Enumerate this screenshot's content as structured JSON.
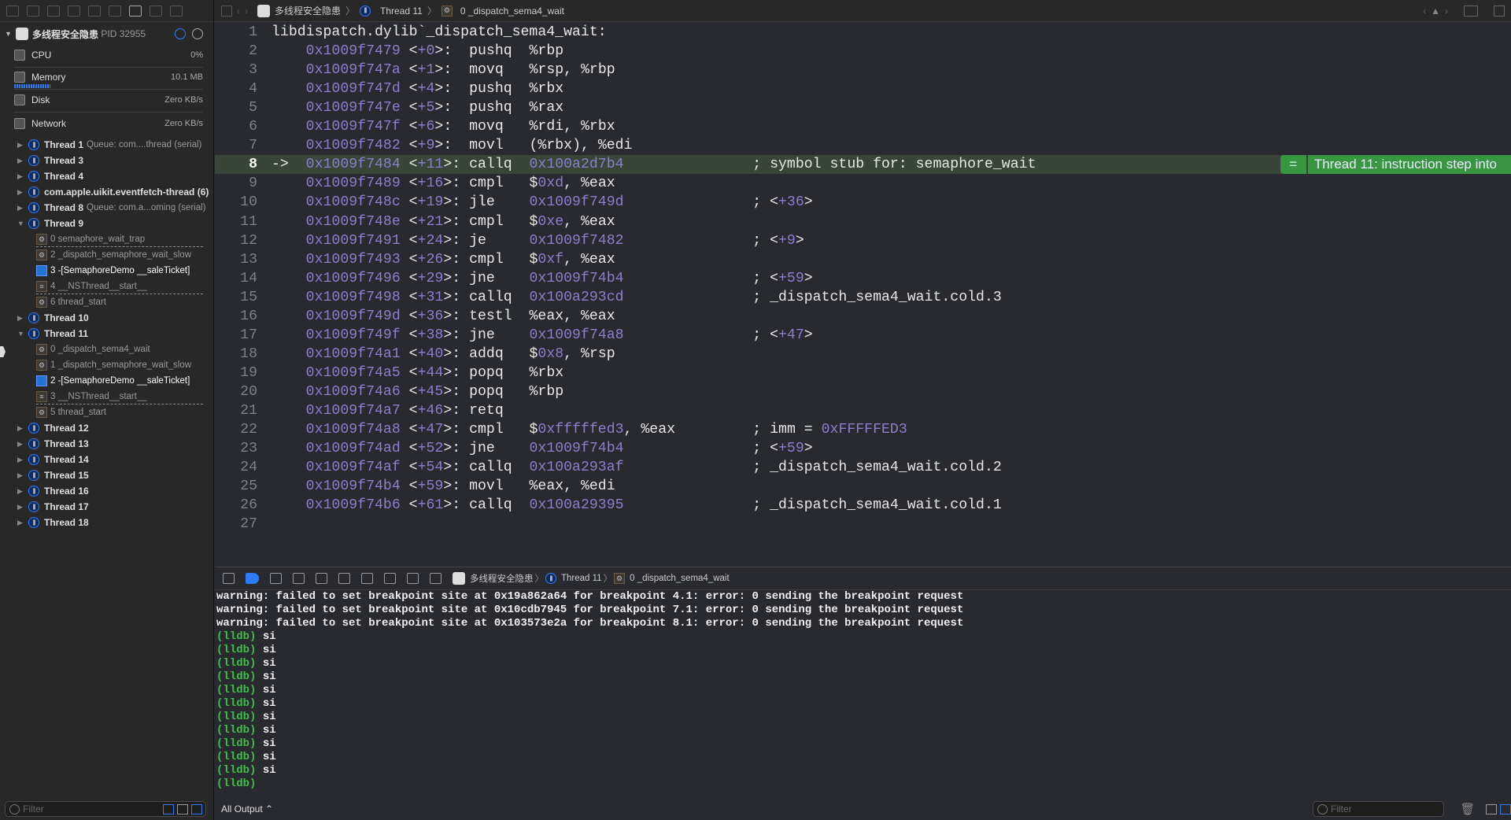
{
  "process": {
    "name": "多线程安全隐患",
    "pid": "PID 32955"
  },
  "metrics": [
    {
      "label": "CPU",
      "value": "0%"
    },
    {
      "label": "Memory",
      "value": "10.1 MB"
    },
    {
      "label": "Disk",
      "value": "Zero KB/s"
    },
    {
      "label": "Network",
      "value": "Zero KB/s"
    }
  ],
  "threads": [
    {
      "label": "Thread 1",
      "queue": "Queue: com....thread (serial)",
      "expanded": false
    },
    {
      "label": "Thread 3",
      "queue": "",
      "expanded": false
    },
    {
      "label": "Thread 4",
      "queue": "",
      "expanded": false
    },
    {
      "label": "com.apple.uikit.eventfetch-thread (6)",
      "queue": "",
      "expanded": false
    },
    {
      "label": "Thread 8",
      "queue": "Queue: com.a...oming (serial)",
      "expanded": false
    },
    {
      "label": "Thread 9",
      "queue": "",
      "expanded": true,
      "frames": [
        {
          "label": "0 semaphore_wait_trap",
          "kind": "sys",
          "sepAfter": true
        },
        {
          "label": "2 _dispatch_semaphore_wait_slow",
          "kind": "sys"
        },
        {
          "label": "3 -[SemaphoreDemo __saleTicket]",
          "kind": "user"
        },
        {
          "label": "4 __NSThread__start__",
          "kind": "fw",
          "sepAfter": true
        },
        {
          "label": "6 thread_start",
          "kind": "sys"
        }
      ]
    },
    {
      "label": "Thread 10",
      "queue": "",
      "expanded": false
    },
    {
      "label": "Thread 11",
      "queue": "",
      "expanded": true,
      "frames": [
        {
          "label": "0 _dispatch_sema4_wait",
          "kind": "sys"
        },
        {
          "label": "1 _dispatch_semaphore_wait_slow",
          "kind": "sys"
        },
        {
          "label": "2 -[SemaphoreDemo __saleTicket]",
          "kind": "user"
        },
        {
          "label": "3 __NSThread__start__",
          "kind": "fw",
          "sepAfter": true
        },
        {
          "label": "5 thread_start",
          "kind": "sys"
        }
      ]
    },
    {
      "label": "Thread 12",
      "queue": "",
      "expanded": false
    },
    {
      "label": "Thread 13",
      "queue": "",
      "expanded": false
    },
    {
      "label": "Thread 14",
      "queue": "",
      "expanded": false
    },
    {
      "label": "Thread 15",
      "queue": "",
      "expanded": false
    },
    {
      "label": "Thread 16",
      "queue": "",
      "expanded": false
    },
    {
      "label": "Thread 17",
      "queue": "",
      "expanded": false
    },
    {
      "label": "Thread 18",
      "queue": "",
      "expanded": false
    }
  ],
  "breadcrumb": {
    "process": "多线程安全隐患",
    "thread": "Thread 11",
    "frame": "0 _dispatch_sema4_wait"
  },
  "code": {
    "header": "libdispatch.dylib`_dispatch_sema4_wait:",
    "current_line": 8,
    "lines": [
      [
        "0x1009f7479",
        "+0",
        "pushq",
        "%rbp",
        ""
      ],
      [
        "0x1009f747a",
        "+1",
        "movq",
        "%rsp, %rbp",
        ""
      ],
      [
        "0x1009f747d",
        "+4",
        "pushq",
        "%rbx",
        ""
      ],
      [
        "0x1009f747e",
        "+5",
        "pushq",
        "%rax",
        ""
      ],
      [
        "0x1009f747f",
        "+6",
        "movq",
        "%rdi, %rbx",
        ""
      ],
      [
        "0x1009f7482",
        "+9",
        "movl",
        "(%rbx), %edi",
        ""
      ],
      [
        "0x1009f7484",
        "+11",
        "callq",
        "0x100a2d7b4",
        "; symbol stub for: semaphore_wait"
      ],
      [
        "0x1009f7489",
        "+16",
        "cmpl",
        "$0xd, %eax",
        ""
      ],
      [
        "0x1009f748c",
        "+19",
        "jle",
        "0x1009f749d",
        "; <+36>"
      ],
      [
        "0x1009f748e",
        "+21",
        "cmpl",
        "$0xe, %eax",
        ""
      ],
      [
        "0x1009f7491",
        "+24",
        "je",
        "0x1009f7482",
        "; <+9>"
      ],
      [
        "0x1009f7493",
        "+26",
        "cmpl",
        "$0xf, %eax",
        ""
      ],
      [
        "0x1009f7496",
        "+29",
        "jne",
        "0x1009f74b4",
        "; <+59>"
      ],
      [
        "0x1009f7498",
        "+31",
        "callq",
        "0x100a293cd",
        "; _dispatch_sema4_wait.cold.3"
      ],
      [
        "0x1009f749d",
        "+36",
        "testl",
        "%eax, %eax",
        ""
      ],
      [
        "0x1009f749f",
        "+38",
        "jne",
        "0x1009f74a8",
        "; <+47>"
      ],
      [
        "0x1009f74a1",
        "+40",
        "addq",
        "$0x8, %rsp",
        ""
      ],
      [
        "0x1009f74a5",
        "+44",
        "popq",
        "%rbx",
        ""
      ],
      [
        "0x1009f74a6",
        "+45",
        "popq",
        "%rbp",
        ""
      ],
      [
        "0x1009f74a7",
        "+46",
        "retq",
        "",
        ""
      ],
      [
        "0x1009f74a8",
        "+47",
        "cmpl",
        "$0xfffffed3, %eax",
        "; imm = 0xFFFFFED3"
      ],
      [
        "0x1009f74ad",
        "+52",
        "jne",
        "0x1009f74b4",
        "; <+59>"
      ],
      [
        "0x1009f74af",
        "+54",
        "callq",
        "0x100a293af",
        "; _dispatch_sema4_wait.cold.2"
      ],
      [
        "0x1009f74b4",
        "+59",
        "movl",
        "%eax, %edi",
        ""
      ],
      [
        "0x1009f74b6",
        "+61",
        "callq",
        "0x100a29395",
        "; _dispatch_sema4_wait.cold.1"
      ]
    ],
    "arrow": "->"
  },
  "annotation": {
    "icon": "=",
    "text": "Thread 11: instruction step into"
  },
  "console": {
    "lines": [
      "warning: failed to set breakpoint site at 0x19a862a64 for breakpoint 4.1: error: 0 sending the breakpoint request",
      "warning: failed to set breakpoint site at 0x10cdb7945 for breakpoint 7.1: error: 0 sending the breakpoint request",
      "warning: failed to set breakpoint site at 0x103573e2a for breakpoint 8.1: error: 0 sending the breakpoint request"
    ],
    "prompt": "(lldb)",
    "commands": [
      "si",
      "si",
      "si",
      "si",
      "si",
      "si",
      "si",
      "si",
      "si",
      "si",
      "si",
      ""
    ]
  },
  "bottom": {
    "filter_placeholder": "Filter",
    "output_select": "All Output ⌃",
    "console_filter_placeholder": "Filter"
  },
  "colors": {
    "accent": "#2f7bf5",
    "highlight_line": "#384538",
    "annotation": "#37963f",
    "number": "#8c7fce",
    "prompt": "#3fbf4a"
  }
}
